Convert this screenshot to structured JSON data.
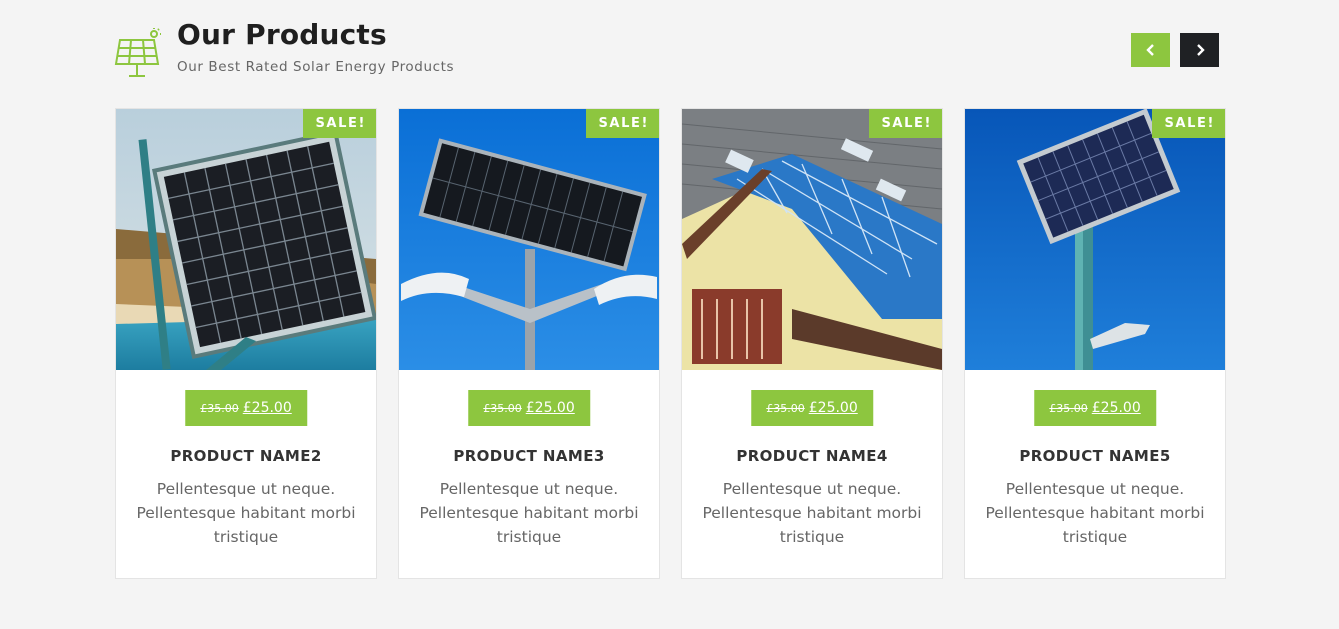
{
  "section": {
    "title": "Our Products",
    "subtitle": "Our Best Rated Solar Energy Products"
  },
  "navigation": {
    "prev_icon": "chevron-left-icon",
    "next_icon": "chevron-right-icon"
  },
  "colors": {
    "accent": "#8dc63f",
    "dark": "#1f2124",
    "background": "#f4f4f4"
  },
  "products": [
    {
      "name": "PRODUCT NAME2",
      "badge": "SALE!",
      "old_price": "£35.00",
      "new_price": "£25.00",
      "description": "Pellentesque ut neque. Pellentesque habitant morbi tristique",
      "image": "solar-panel-seaside"
    },
    {
      "name": "PRODUCT NAME3",
      "badge": "SALE!",
      "old_price": "£35.00",
      "new_price": "£25.00",
      "description": "Pellentesque ut neque. Pellentesque habitant morbi tristique",
      "image": "solar-street-light-double"
    },
    {
      "name": "PRODUCT NAME4",
      "badge": "SALE!",
      "old_price": "£35.00",
      "new_price": "£25.00",
      "description": "Pellentesque ut neque. Pellentesque habitant morbi tristique",
      "image": "solar-roof-house"
    },
    {
      "name": "PRODUCT NAME5",
      "badge": "SALE!",
      "old_price": "£35.00",
      "new_price": "£25.00",
      "description": "Pellentesque ut neque. Pellentesque habitant morbi tristique",
      "image": "solar-street-light-single"
    }
  ]
}
